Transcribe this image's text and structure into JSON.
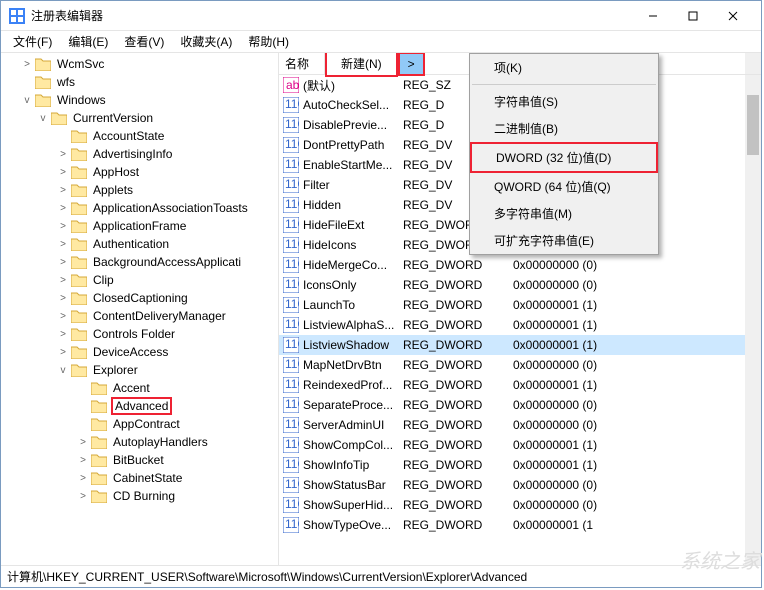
{
  "title": "注册表编辑器",
  "menu": {
    "file": "文件(F)",
    "edit": "编辑(E)",
    "view": "查看(V)",
    "favorites": "收藏夹(A)",
    "help": "帮助(H)"
  },
  "tree": {
    "items": [
      {
        "indent": 20,
        "toggle": ">",
        "label": "WcmSvc"
      },
      {
        "indent": 20,
        "toggle": "",
        "label": "wfs"
      },
      {
        "indent": 20,
        "toggle": "v",
        "label": "Windows"
      },
      {
        "indent": 36,
        "toggle": "v",
        "label": "CurrentVersion"
      },
      {
        "indent": 56,
        "toggle": "",
        "label": "AccountState"
      },
      {
        "indent": 56,
        "toggle": ">",
        "label": "AdvertisingInfo"
      },
      {
        "indent": 56,
        "toggle": ">",
        "label": "AppHost"
      },
      {
        "indent": 56,
        "toggle": ">",
        "label": "Applets"
      },
      {
        "indent": 56,
        "toggle": ">",
        "label": "ApplicationAssociationToasts"
      },
      {
        "indent": 56,
        "toggle": ">",
        "label": "ApplicationFrame"
      },
      {
        "indent": 56,
        "toggle": ">",
        "label": "Authentication"
      },
      {
        "indent": 56,
        "toggle": ">",
        "label": "BackgroundAccessApplicati"
      },
      {
        "indent": 56,
        "toggle": ">",
        "label": "Clip"
      },
      {
        "indent": 56,
        "toggle": ">",
        "label": "ClosedCaptioning"
      },
      {
        "indent": 56,
        "toggle": ">",
        "label": "ContentDeliveryManager"
      },
      {
        "indent": 56,
        "toggle": ">",
        "label": "Controls Folder"
      },
      {
        "indent": 56,
        "toggle": ">",
        "label": "DeviceAccess"
      },
      {
        "indent": 56,
        "toggle": "v",
        "label": "Explorer"
      },
      {
        "indent": 76,
        "toggle": "",
        "label": "Accent"
      },
      {
        "indent": 76,
        "toggle": "",
        "label": "Advanced",
        "highlight": true
      },
      {
        "indent": 76,
        "toggle": "",
        "label": "AppContract"
      },
      {
        "indent": 76,
        "toggle": ">",
        "label": "AutoplayHandlers"
      },
      {
        "indent": 76,
        "toggle": ">",
        "label": "BitBucket"
      },
      {
        "indent": 76,
        "toggle": ">",
        "label": "CabinetState"
      },
      {
        "indent": 76,
        "toggle": ">",
        "label": "CD Burning"
      }
    ]
  },
  "list": {
    "header_name": "名称",
    "new_label": "新建(N)",
    "arrow": ">",
    "rows": [
      {
        "icon": "sz",
        "name": "(默认)",
        "type": "REG_SZ",
        "data": ""
      },
      {
        "icon": "dw",
        "name": "AutoCheckSel...",
        "type": "REG_D",
        "data": ""
      },
      {
        "icon": "dw",
        "name": "DisablePrevie...",
        "type": "REG_D",
        "data": ""
      },
      {
        "icon": "dw",
        "name": "DontPrettyPath",
        "type": "REG_DV",
        "data": ""
      },
      {
        "icon": "dw",
        "name": "EnableStartMe...",
        "type": "REG_DV",
        "data": ""
      },
      {
        "icon": "dw",
        "name": "Filter",
        "type": "REG_DV",
        "data": ""
      },
      {
        "icon": "dw",
        "name": "Hidden",
        "type": "REG_DV",
        "data": ""
      },
      {
        "icon": "dw",
        "name": "HideFileExt",
        "type": "REG_DWORD",
        "data": "0x00000000 (0)"
      },
      {
        "icon": "dw",
        "name": "HideIcons",
        "type": "REG_DWORD",
        "data": "0x00000000 (0)"
      },
      {
        "icon": "dw",
        "name": "HideMergeCo...",
        "type": "REG_DWORD",
        "data": "0x00000000 (0)"
      },
      {
        "icon": "dw",
        "name": "IconsOnly",
        "type": "REG_DWORD",
        "data": "0x00000000 (0)"
      },
      {
        "icon": "dw",
        "name": "LaunchTo",
        "type": "REG_DWORD",
        "data": "0x00000001 (1)"
      },
      {
        "icon": "dw",
        "name": "ListviewAlphaS...",
        "type": "REG_DWORD",
        "data": "0x00000001 (1)"
      },
      {
        "icon": "dw",
        "name": "ListviewShadow",
        "type": "REG_DWORD",
        "data": "0x00000001 (1)",
        "selected": true
      },
      {
        "icon": "dw",
        "name": "MapNetDrvBtn",
        "type": "REG_DWORD",
        "data": "0x00000000 (0)"
      },
      {
        "icon": "dw",
        "name": "ReindexedProf...",
        "type": "REG_DWORD",
        "data": "0x00000001 (1)"
      },
      {
        "icon": "dw",
        "name": "SeparateProce...",
        "type": "REG_DWORD",
        "data": "0x00000000 (0)"
      },
      {
        "icon": "dw",
        "name": "ServerAdminUI",
        "type": "REG_DWORD",
        "data": "0x00000000 (0)"
      },
      {
        "icon": "dw",
        "name": "ShowCompCol...",
        "type": "REG_DWORD",
        "data": "0x00000001 (1)"
      },
      {
        "icon": "dw",
        "name": "ShowInfoTip",
        "type": "REG_DWORD",
        "data": "0x00000001 (1)"
      },
      {
        "icon": "dw",
        "name": "ShowStatusBar",
        "type": "REG_DWORD",
        "data": "0x00000000 (0)"
      },
      {
        "icon": "dw",
        "name": "ShowSuperHid...",
        "type": "REG_DWORD",
        "data": "0x00000000 (0)"
      },
      {
        "icon": "dw",
        "name": "ShowTypeOve...",
        "type": "REG_DWORD",
        "data": "0x00000001 (1"
      }
    ]
  },
  "context": {
    "key": "项(K)",
    "string": "字符串值(S)",
    "binary": "二进制值(B)",
    "dword": "DWORD (32 位)值(D)",
    "qword": "QWORD (64 位)值(Q)",
    "multi": "多字符串值(M)",
    "expand": "可扩充字符串值(E)"
  },
  "statusbar": "计算机\\HKEY_CURRENT_USER\\Software\\Microsoft\\Windows\\CurrentVersion\\Explorer\\Advanced",
  "watermark": "系统之家"
}
